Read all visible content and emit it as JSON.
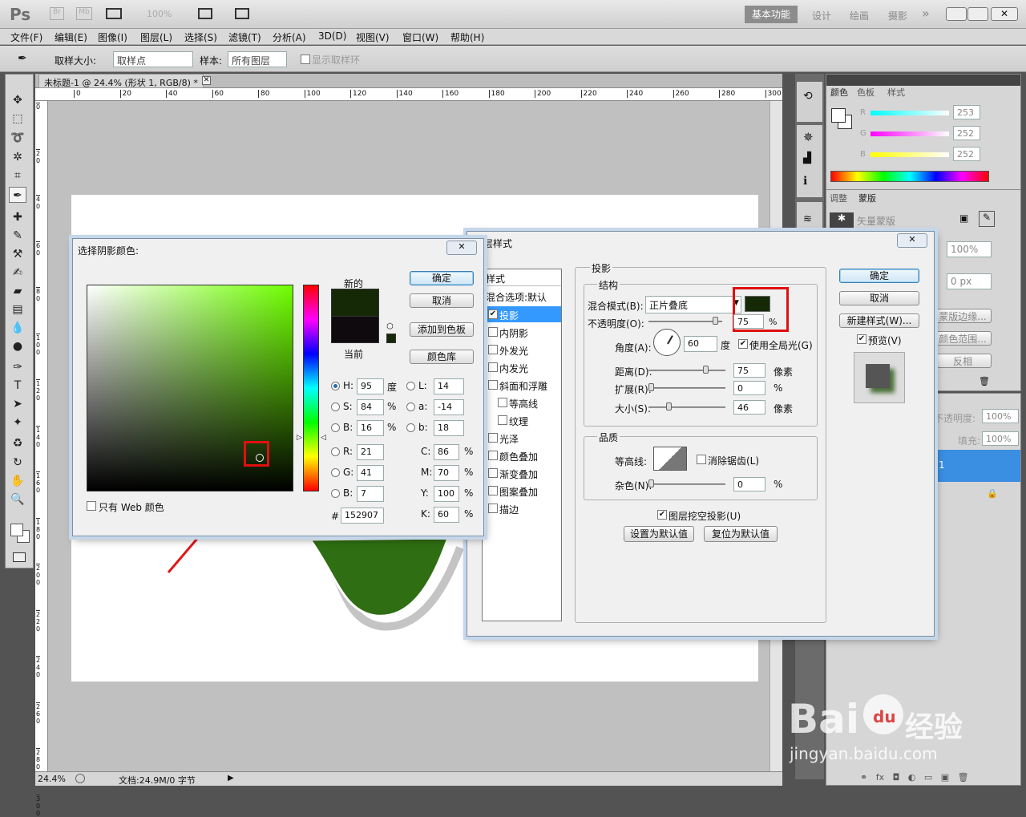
{
  "app": {
    "logo": "Ps",
    "br": "Br",
    "mb": "Mb",
    "zoom": "100%",
    "workspaces": [
      "基本功能",
      "设计",
      "绘画",
      "摄影"
    ],
    "more": "»"
  },
  "menu": [
    "文件(F)",
    "编辑(E)",
    "图像(I)",
    "图层(L)",
    "选择(S)",
    "滤镜(T)",
    "分析(A)",
    "3D(D)",
    "视图(V)",
    "窗口(W)",
    "帮助(H)"
  ],
  "options": {
    "sample_size_label": "取样大小:",
    "sample_size": "取样点",
    "sample_label": "样本:",
    "sample": "所有图层",
    "show_ring": "显示取样环"
  },
  "doc": {
    "tab_title": "未标题-1 @ 24.4% (形状 1, RGB/8) *",
    "ruler_h": [
      "0",
      "20",
      "40",
      "60",
      "80",
      "100",
      "120",
      "140",
      "160",
      "180",
      "200",
      "220",
      "240",
      "260",
      "280",
      "300"
    ],
    "ruler_v": [
      "0",
      "2\n0",
      "4\n0",
      "6\n0",
      "8\n0",
      "1\n0\n0",
      "1\n2\n0",
      "1\n4\n0",
      "1\n6\n0",
      "1\n8\n0",
      "2\n0\n0",
      "2\n2\n0",
      "2\n4\n0",
      "2\n6\n0",
      "2\n8\n0",
      "3\n0\n0"
    ],
    "status_zoom": "24.4%",
    "status_doc": "文档:24.9M/0 字节"
  },
  "color_panel": {
    "tabs": [
      "颜色",
      "色板",
      "样式"
    ],
    "r_label": "R",
    "g_label": "G",
    "b_label": "B",
    "r": "253",
    "g": "252",
    "b": "252"
  },
  "adjust_panel": {
    "tabs": [
      "调整",
      "蒙版"
    ],
    "vector_mask": "矢量蒙版",
    "density": "100%",
    "feather": "0 px",
    "buttons": [
      "蒙版边缘...",
      "颜色范围...",
      "反相"
    ]
  },
  "layers_panel": {
    "opacity_label": "不透明度:",
    "opacity": "100%",
    "fill_label": "填充:",
    "fill": "100%",
    "layer_text": "1"
  },
  "picker": {
    "title": "选择阴影颜色:",
    "new_label": "新的",
    "current_label": "当前",
    "ok": "确定",
    "cancel": "取消",
    "add_swatch": "添加到色板",
    "color_lib": "颜色库",
    "web_only": "只有 Web 颜色",
    "fields": [
      {
        "k": "H:",
        "v": "95",
        "u": "度"
      },
      {
        "k": "S:",
        "v": "84",
        "u": "%"
      },
      {
        "k": "B:",
        "v": "16",
        "u": "%"
      },
      {
        "k": "R:",
        "v": "21",
        "u": ""
      },
      {
        "k": "G:",
        "v": "41",
        "u": ""
      },
      {
        "k": "B:",
        "v": "7",
        "u": ""
      }
    ],
    "lab": [
      {
        "k": "L:",
        "v": "14"
      },
      {
        "k": "a:",
        "v": "-14"
      },
      {
        "k": "b:",
        "v": "18"
      }
    ],
    "cmyk": [
      {
        "k": "C:",
        "v": "86",
        "u": "%"
      },
      {
        "k": "M:",
        "v": "70",
        "u": "%"
      },
      {
        "k": "Y:",
        "v": "100",
        "u": "%"
      },
      {
        "k": "K:",
        "v": "60",
        "u": "%"
      }
    ],
    "hex_label": "#",
    "hex": "152907",
    "new_color": "#152907",
    "current_color": "#0f0a0e"
  },
  "layer_style": {
    "title": "图层样式",
    "styles_header": "样式",
    "blend_default": "混合选项:默认",
    "items": [
      "投影",
      "内阴影",
      "外发光",
      "内发光",
      "斜面和浮雕",
      "等高线",
      "纹理",
      "光泽",
      "颜色叠加",
      "渐变叠加",
      "图案叠加",
      "描边"
    ],
    "section": "投影",
    "structure": "结构",
    "blend_mode_label": "混合模式(B):",
    "blend_mode": "正片叠底",
    "opacity_label": "不透明度(O):",
    "opacity": "75",
    "pct": "%",
    "angle_label": "角度(A):",
    "angle": "60",
    "deg": "度",
    "global_light": "使用全局光(G)",
    "distance_label": "距离(D):",
    "distance": "75",
    "px": "像素",
    "spread_label": "扩展(R):",
    "spread": "0",
    "size_label": "大小(S):",
    "size": "46",
    "quality": "品质",
    "contour_label": "等高线:",
    "anti_alias": "消除锯齿(L)",
    "noise_label": "杂色(N):",
    "noise": "0",
    "knockout": "图层挖空投影(U)",
    "make_default": "设置为默认值",
    "reset_default": "复位为默认值",
    "ok": "确定",
    "cancel": "取消",
    "new_style": "新建样式(W)...",
    "preview": "预览(V)",
    "shadow_color": "#152907"
  },
  "watermark": {
    "brand": "Bai",
    "du": "du",
    "jy": "经验",
    "url": "jingyan.baidu.com"
  }
}
